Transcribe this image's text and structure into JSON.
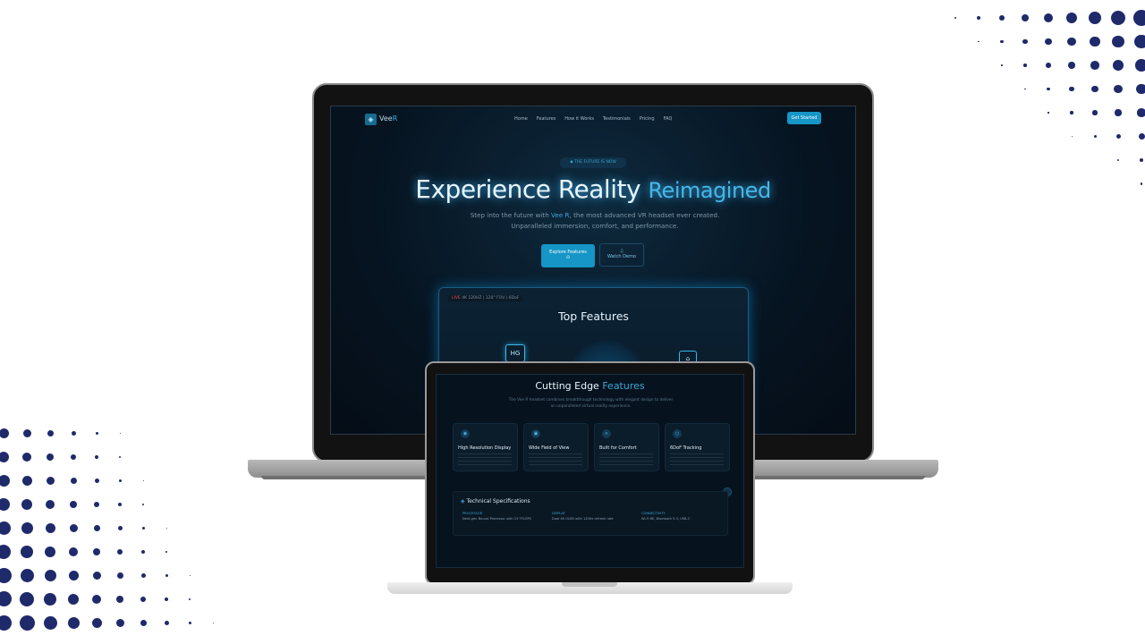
{
  "main_site": {
    "logo_text": "Vee",
    "logo_accent": "R",
    "nav_links": [
      "Home",
      "Features",
      "How it Works",
      "Testimonials",
      "Pricing",
      "FAQ"
    ],
    "cta": "Get Started",
    "badge": "THE FUTURE IS NOW",
    "hero_title_main": "Experience Reality",
    "hero_title_accent": "Reimagined",
    "hero_sub_1": "Step into the future with",
    "hero_sub_brand": "Vee R",
    "hero_sub_2": ", the most advanced VR headset ever created. Unparalleled immersion, comfort, and performance.",
    "explore_btn": "Explore Features",
    "demo_btn": "Watch Demo",
    "live_label": "LIVE",
    "live_info": "4K 120HZ | 120° FOV | 6DoF",
    "top_features_title": "Top Features",
    "hg_label": "HG"
  },
  "second_site": {
    "title_main": "Cutting Edge",
    "title_accent": "Features",
    "subtitle": "The Vee R headset combines breakthrough technology with elegant design to deliver an unparalleled virtual reality experience.",
    "feature_cards": [
      {
        "title": "High Resolution Display",
        "icon": "eye-icon"
      },
      {
        "title": "Wide Field of View",
        "icon": "view-icon"
      },
      {
        "title": "Built for Comfort",
        "icon": "headphone-icon"
      },
      {
        "title": "6DoF Tracking",
        "icon": "tracking-icon"
      }
    ],
    "specs_title": "Technical Specifications",
    "specs": [
      {
        "head": "PROCESSOR",
        "value": "Next-gen Neural Processor with 15 TFLOPS"
      },
      {
        "head": "DISPLAY",
        "value": "Dual 4K OLED with 120Hz refresh rate"
      },
      {
        "head": "CONNECTIVITY",
        "value": "Wi-Fi 6E, Bluetooth 5.3, USB-C"
      }
    ]
  },
  "colors": {
    "accent": "#1596c6",
    "dots": "#1f2a6b"
  }
}
